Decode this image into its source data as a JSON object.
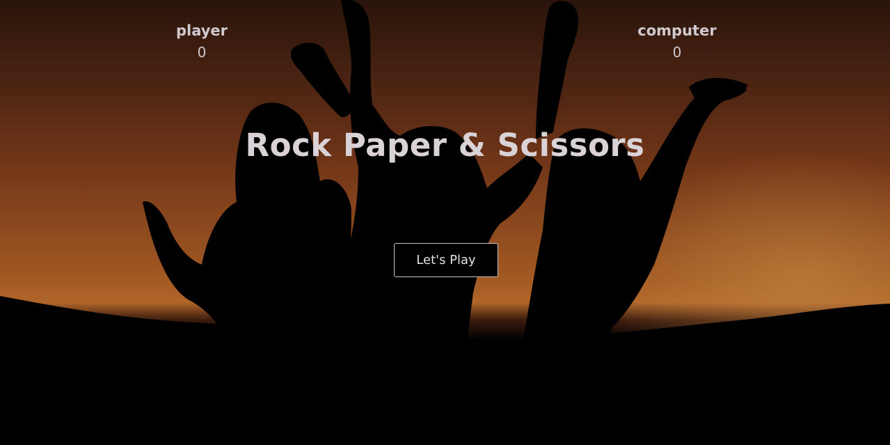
{
  "scoreboard": {
    "player": {
      "label": "player",
      "score": "0"
    },
    "computer": {
      "label": "computer",
      "score": "0"
    }
  },
  "hero": {
    "title": "Rock Paper & Scissors",
    "play_button_label": "Let's Play"
  },
  "colors": {
    "text": "#cfc9d0",
    "sunset_top": "#2a140b",
    "sunset_glow": "#b0652a",
    "silhouette": "#000000"
  }
}
